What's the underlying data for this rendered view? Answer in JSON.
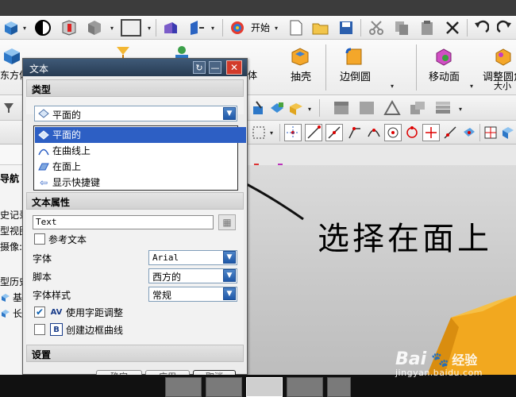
{
  "toolbar": {
    "start_label": "开始",
    "dropdown_glyph": "▾"
  },
  "ribbon": {
    "left_partial": "东方体",
    "body_partial": "体",
    "shell": "抽壳",
    "edge_blend": "边倒圆",
    "move_face": "移动面",
    "resize_partial": "调整圆角",
    "resize_sub": "大小"
  },
  "left_panel": {
    "nav_partial": "导航",
    "items": [
      "史记录",
      "型视图",
      "摄像:",
      "型历史",
      "基",
      "长"
    ]
  },
  "dialog": {
    "title": "文本",
    "sections": {
      "type": "类型",
      "text_props": "文本属性",
      "settings": "设置"
    },
    "type_combo_value": "平面的",
    "type_options": [
      "平面的",
      "在曲线上",
      "在面上",
      "显示快捷键"
    ],
    "text_input_value": "Text",
    "ref_text_label": "参考文本",
    "font_label": "字体",
    "font_value": "Arial",
    "script_label": "脚本",
    "script_value": "西方的",
    "style_label": "字体样式",
    "style_value": "常规",
    "kerning_label": "使用字距调整",
    "kerning_checked": true,
    "border_curve_label": "创建边框曲线",
    "border_checked": false,
    "buttons": [
      "确定",
      "应用",
      "取消"
    ]
  },
  "annotation": "选择在面上",
  "watermark": {
    "brand": "Bai",
    "brand2": "经验",
    "url": "jingyan.baidu.com"
  },
  "colors": {
    "selected_item": "#2d5fc4",
    "title_bar": "#273b52",
    "orange_solid": "#f2a81f"
  }
}
